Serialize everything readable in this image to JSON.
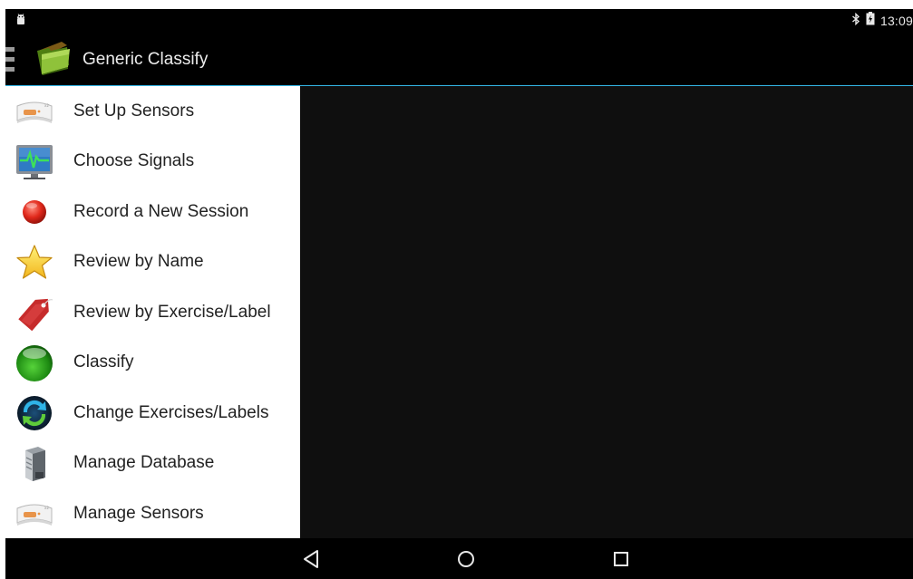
{
  "status_bar": {
    "notification_icon": "android-debug-icon",
    "bluetooth_icon": "bluetooth-icon",
    "battery_icon": "battery-charging-icon",
    "time": "13:09"
  },
  "action_bar": {
    "drawer_icon": "drawer-indicator-icon",
    "app_icon": "folder-icon",
    "title": "Generic Classify",
    "accent_color": "#33b5e5"
  },
  "drawer": {
    "items": [
      {
        "label": "Set Up Sensors",
        "icon": "sensor-card-icon"
      },
      {
        "label": "Choose Signals",
        "icon": "monitor-signal-icon"
      },
      {
        "label": "Record a New Session",
        "icon": "record-icon"
      },
      {
        "label": "Review by Name",
        "icon": "star-icon"
      },
      {
        "label": "Review by Exercise/Label",
        "icon": "tag-icon"
      },
      {
        "label": "Classify",
        "icon": "green-ball-icon"
      },
      {
        "label": "Change Exercises/Labels",
        "icon": "sync-icon"
      },
      {
        "label": "Manage Database",
        "icon": "server-icon"
      },
      {
        "label": "Manage Sensors",
        "icon": "sensor-card-icon"
      }
    ]
  },
  "nav_bar": {
    "back_icon": "back-icon",
    "home_icon": "home-icon",
    "recents_icon": "recents-icon"
  },
  "colors": {
    "background": "#000000",
    "content": "#0f0f0f",
    "drawer": "#ffffff",
    "accent": "#33b5e5"
  }
}
